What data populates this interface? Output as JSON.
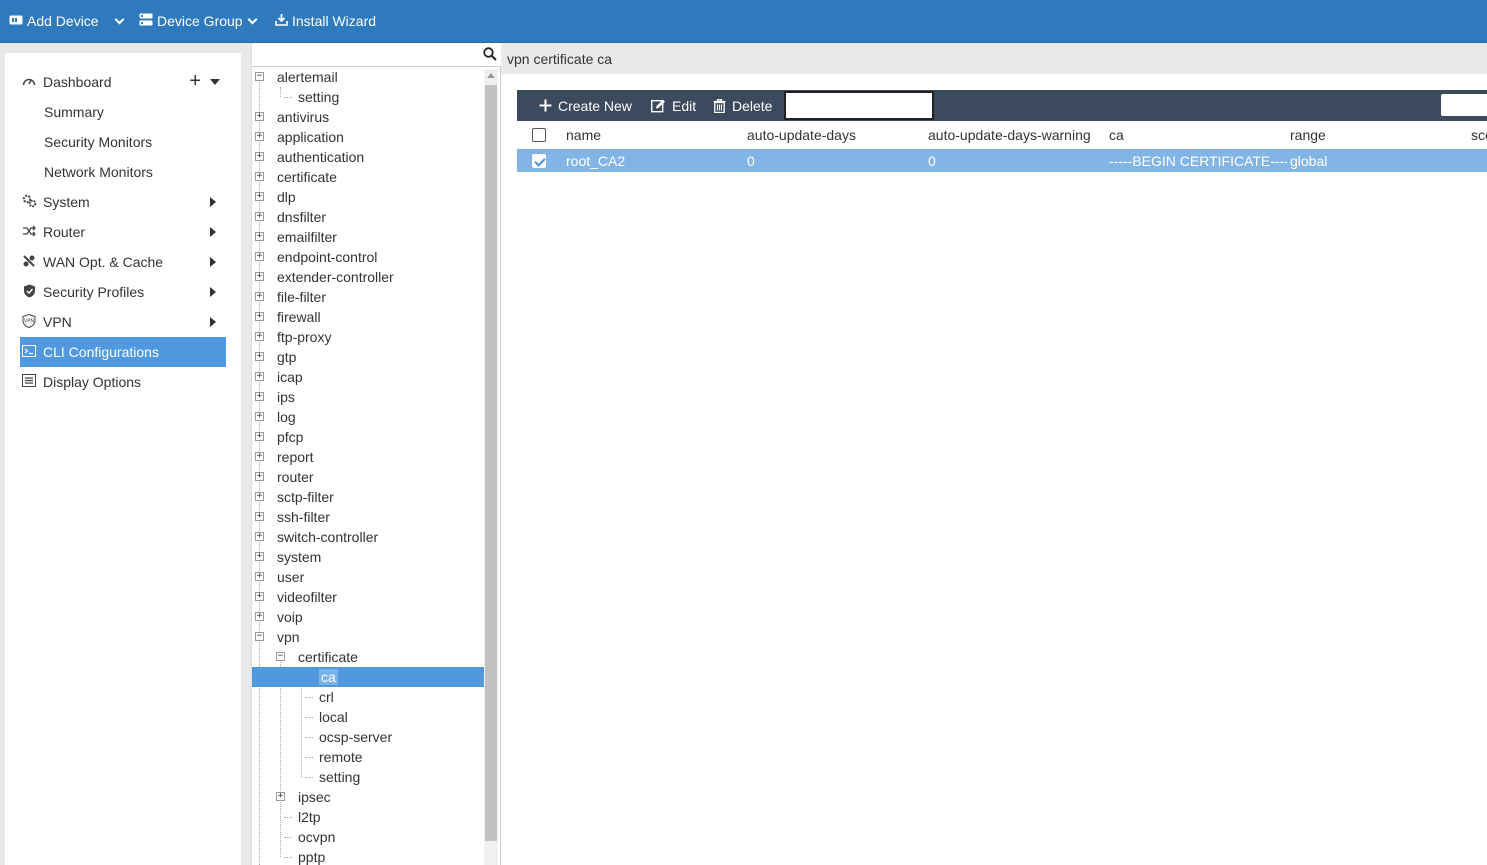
{
  "topbar": {
    "add_device": "Add Device",
    "device_group": "Device Group",
    "install_wizard": "Install Wizard"
  },
  "nav": {
    "dashboard": "Dashboard",
    "summary": "Summary",
    "security_monitors": "Security Monitors",
    "network_monitors": "Network Monitors",
    "system": "System",
    "router": "Router",
    "wan_opt": "WAN Opt. & Cache",
    "security_profiles": "Security Profiles",
    "vpn": "VPN",
    "cli_configurations": "CLI Configurations",
    "display_options": "Display Options"
  },
  "tree": {
    "search_placeholder": "",
    "items": [
      "alertemail",
      "setting",
      "antivirus",
      "application",
      "authentication",
      "certificate",
      "dlp",
      "dnsfilter",
      "emailfilter",
      "endpoint-control",
      "extender-controller",
      "file-filter",
      "firewall",
      "ftp-proxy",
      "gtp",
      "icap",
      "ips",
      "log",
      "pfcp",
      "report",
      "router",
      "sctp-filter",
      "ssh-filter",
      "switch-controller",
      "system",
      "user",
      "videofilter",
      "voip",
      "vpn",
      "certificate",
      "ca",
      "crl",
      "local",
      "ocsp-server",
      "remote",
      "setting",
      "ipsec",
      "l2tp",
      "ocvpn",
      "pptp"
    ]
  },
  "main": {
    "title": "vpn certificate ca",
    "toolbar": {
      "create_new": "Create New",
      "edit": "Edit",
      "delete": "Delete",
      "search_value": ""
    },
    "columns": [
      "name",
      "auto-update-days",
      "auto-update-days-warning",
      "ca",
      "range",
      "sce"
    ],
    "rows": [
      {
        "name": "root_CA2",
        "auto_update_days": "0",
        "auto_update_days_warning": "0",
        "ca": "-----BEGIN CERTIFICATE----",
        "range": "global",
        "checked": true
      }
    ]
  },
  "colors": {
    "topbar": "#2f79bd",
    "active": "#5198de",
    "selected_row": "#82b5e6",
    "grid_toolbar": "#3b4a5c"
  }
}
